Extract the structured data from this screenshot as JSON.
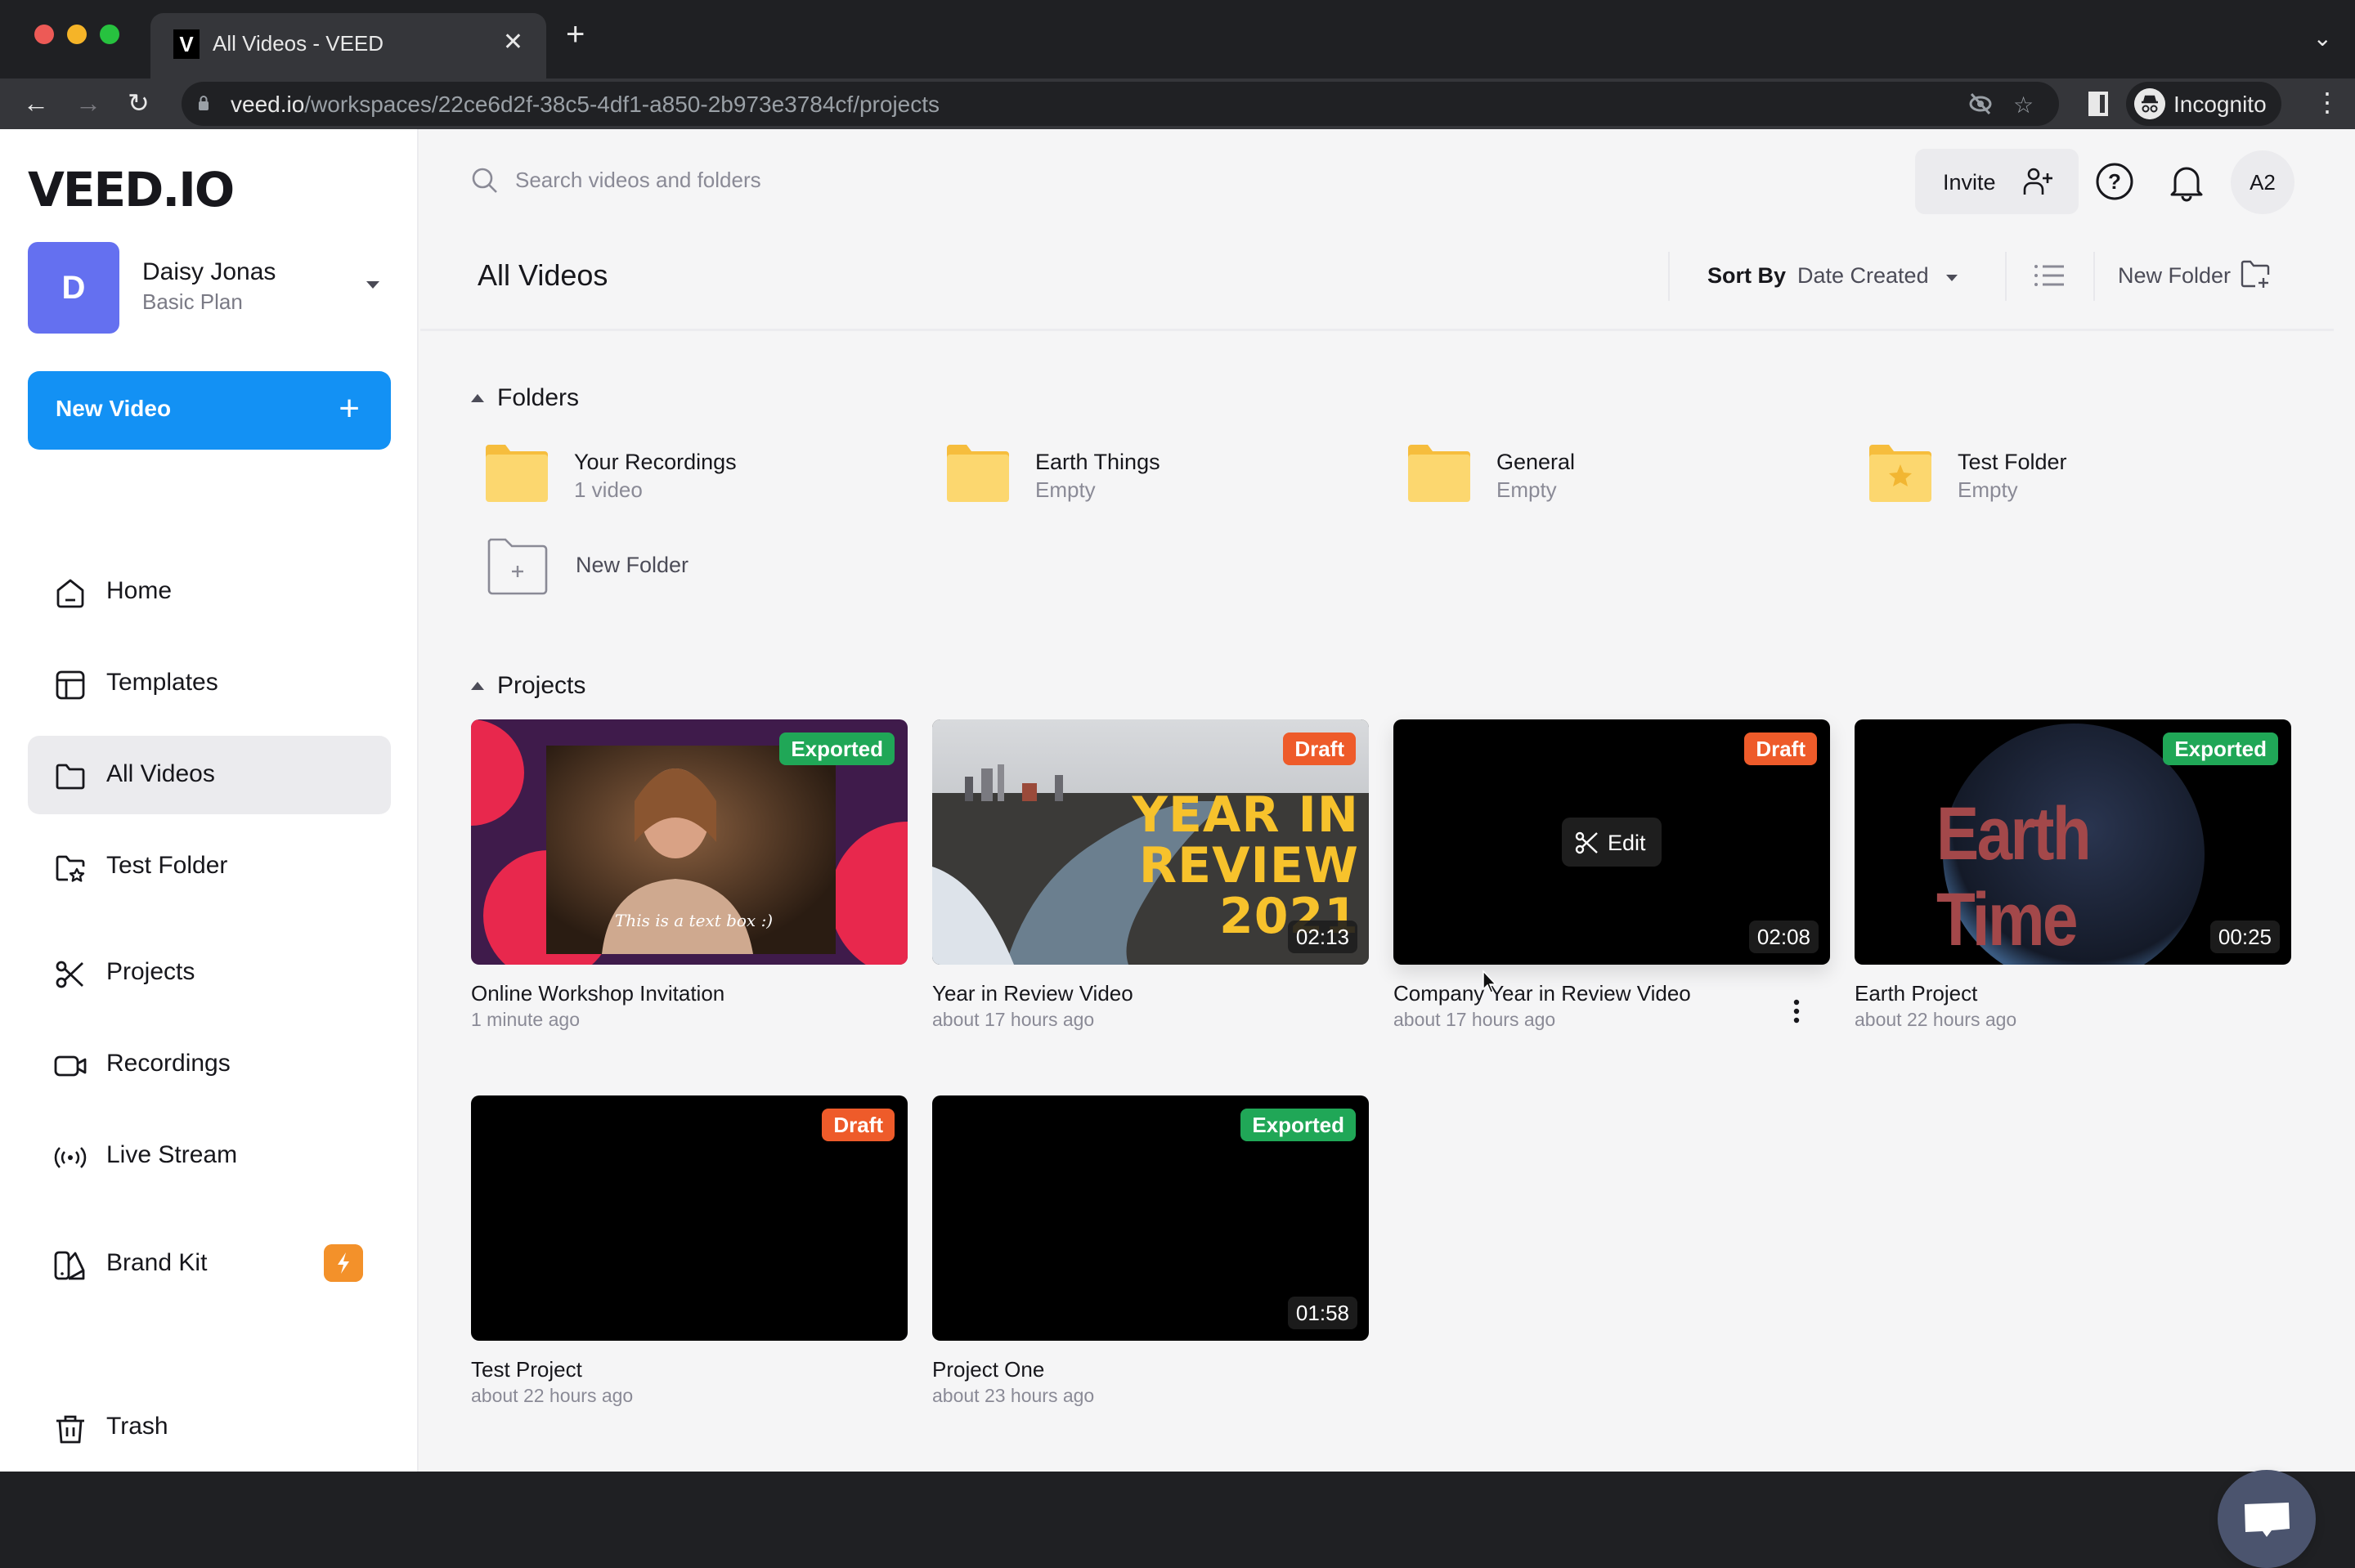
{
  "browser": {
    "tab_title": "All Videos - VEED",
    "tab_favicon": "V",
    "url_host": "veed.io",
    "url_path": "/workspaces/22ce6d2f-38c5-4df1-a850-2b973e3784cf/projects",
    "incognito_label": "Incognito",
    "icons": [
      "back-icon",
      "forward-icon",
      "reload-icon",
      "lock-icon",
      "eye-off-icon",
      "star-icon",
      "side-panel-icon",
      "incognito-icon",
      "kebab-menu-icon",
      "new-tab-icon",
      "tab-close-icon",
      "tab-list-chevron-icon"
    ]
  },
  "sidebar": {
    "logo": "VEED.IO",
    "account": {
      "initial": "D",
      "name": "Daisy Jonas",
      "plan": "Basic Plan",
      "avatar_color": "#6470f0"
    },
    "new_video_label": "New Video",
    "new_video_icon": "+",
    "items": [
      {
        "label": "Home",
        "icon": "home-icon",
        "active": false
      },
      {
        "label": "Templates",
        "icon": "templates-icon",
        "active": false
      },
      {
        "label": "All Videos",
        "icon": "folder-icon",
        "active": true
      },
      {
        "label": "Test Folder",
        "icon": "star-folder-icon",
        "active": false
      },
      {
        "label": "Projects",
        "icon": "scissors-icon",
        "active": false
      },
      {
        "label": "Recordings",
        "icon": "video-camera-icon",
        "active": false
      },
      {
        "label": "Live Stream",
        "icon": "broadcast-icon",
        "active": false
      },
      {
        "label": "Brand Kit",
        "icon": "brand-kit-icon",
        "active": false,
        "badge": "bolt-icon"
      },
      {
        "label": "Trash",
        "icon": "trash-icon",
        "active": false
      }
    ]
  },
  "header": {
    "search_placeholder": "Search videos and folders",
    "search_value": "",
    "invite_label": "Invite",
    "user_initials": "A2",
    "page_title": "All Videos",
    "sort_by_label": "Sort By",
    "sort_value": "Date Created",
    "new_folder_label": "New Folder"
  },
  "folders": {
    "section_title": "Folders",
    "items": [
      {
        "name": "Your Recordings",
        "subtitle": "1 video",
        "starred": false
      },
      {
        "name": "Earth Things",
        "subtitle": "Empty",
        "starred": false
      },
      {
        "name": "General",
        "subtitle": "Empty",
        "starred": false
      },
      {
        "name": "Test Folder",
        "subtitle": "Empty",
        "starred": true
      }
    ],
    "new_folder_label": "New Folder"
  },
  "projects": {
    "section_title": "Projects",
    "items": [
      {
        "title": "Online Workshop Invitation",
        "time": "1 minute ago",
        "status": "Exported",
        "duration": "",
        "thumb": "workshop",
        "thumb_caption": "This is a text box :)"
      },
      {
        "title": "Year in Review Video",
        "time": "about 17 hours ago",
        "status": "Draft",
        "duration": "02:13",
        "thumb": "year-review",
        "thumb_text": [
          "YEAR IN",
          "REVIEW",
          "2021"
        ]
      },
      {
        "title": "Company Year in Review Video",
        "time": "about 17 hours ago",
        "status": "Draft",
        "duration": "02:08",
        "thumb": "black",
        "hover_action": "Edit"
      },
      {
        "title": "Earth Project",
        "time": "about 22 hours ago",
        "status": "Exported",
        "duration": "00:25",
        "thumb": "earth",
        "thumb_text": "Earth Time"
      },
      {
        "title": "Test Project",
        "time": "about 22 hours ago",
        "status": "Draft",
        "duration": "",
        "thumb": "black"
      },
      {
        "title": "Project One",
        "time": "about 23 hours ago",
        "status": "Exported",
        "duration": "01:58",
        "thumb": "black"
      }
    ]
  },
  "colors": {
    "accent": "#1391f4",
    "exported": "#20a757",
    "draft": "#ee5b2a",
    "brand_kit_badge": "#f3912a",
    "chat_fab": "#4b546e"
  }
}
